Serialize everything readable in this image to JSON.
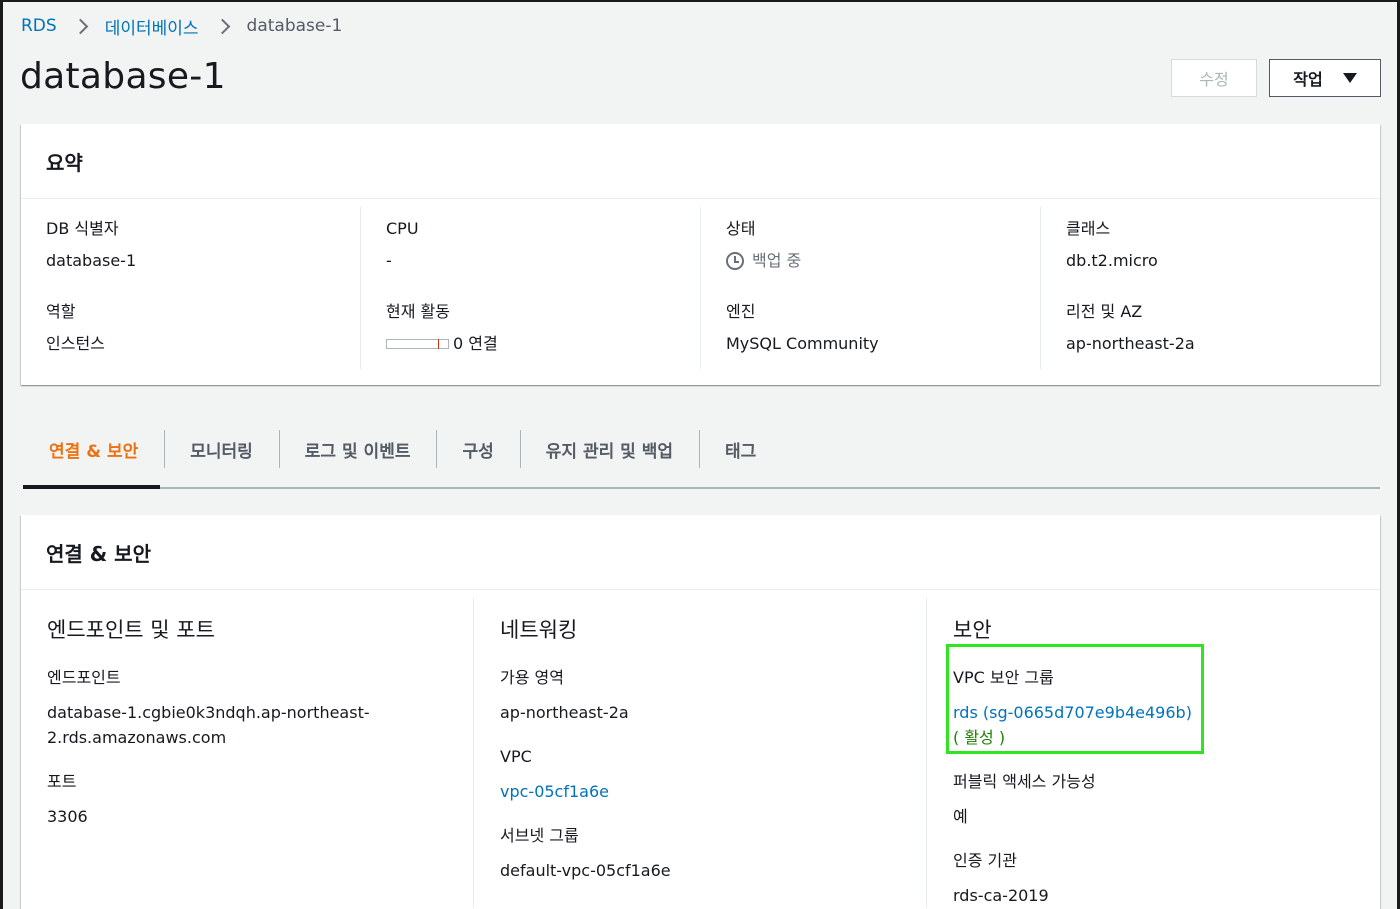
{
  "breadcrumb": {
    "items": [
      "RDS",
      "데이터베이스"
    ],
    "current": "database-1"
  },
  "page": {
    "title": "database-1"
  },
  "header_actions": {
    "edit_label": "수정",
    "action_label": "작업"
  },
  "summary": {
    "title": "요약",
    "columns": [
      {
        "fields": [
          {
            "label": "DB 식별자",
            "value": "database-1"
          },
          {
            "label": "역할",
            "value": "인스턴스"
          }
        ]
      },
      {
        "fields": [
          {
            "label": "CPU",
            "value": "-"
          },
          {
            "label": "현재 활동",
            "value": "0 연결"
          }
        ]
      },
      {
        "fields": [
          {
            "label": "상태",
            "value": "백업 중"
          },
          {
            "label": "엔진",
            "value": "MySQL Community"
          }
        ]
      },
      {
        "fields": [
          {
            "label": "클래스",
            "value": "db.t2.micro"
          },
          {
            "label": "리전 및 AZ",
            "value": "ap-northeast-2a"
          }
        ]
      }
    ]
  },
  "tabs": [
    "연결 & 보안",
    "모니터링",
    "로그 및 이벤트",
    "구성",
    "유지 관리 및 백업",
    "태그"
  ],
  "active_tab": "연결 & 보안",
  "connectivity": {
    "title": "연결 & 보안",
    "endpoint_section": {
      "title": "엔드포인트 및 포트",
      "endpoint_label": "엔드포인트",
      "endpoint_value_line1": "database-1.cgbie0k3ndqh.ap-northeast-",
      "endpoint_value_line2": "2.rds.amazonaws.com",
      "port_label": "포트",
      "port_value": "3306"
    },
    "networking_section": {
      "title": "네트워킹",
      "az_label": "가용 영역",
      "az_value": "ap-northeast-2a",
      "vpc_label": "VPC",
      "vpc_value": "vpc-05cf1a6e",
      "subnet_label": "서브넷 그룹",
      "subnet_value": "default-vpc-05cf1a6e"
    },
    "security_section": {
      "title": "보안",
      "sg_label": "VPC 보안 그룹",
      "sg_value": "rds (sg-0665d707e9b4e496b)",
      "sg_status": "( 활성 )",
      "public_label": "퍼블릭 액세스 가능성",
      "public_value": "예",
      "ca_label": "인증 기관",
      "ca_value": "rds-ca-2019"
    }
  },
  "colors": {
    "link": "#0073bb",
    "active_tab": "#ec7211",
    "status_active": "#1d8102",
    "highlight_box": "#2ee51f"
  }
}
